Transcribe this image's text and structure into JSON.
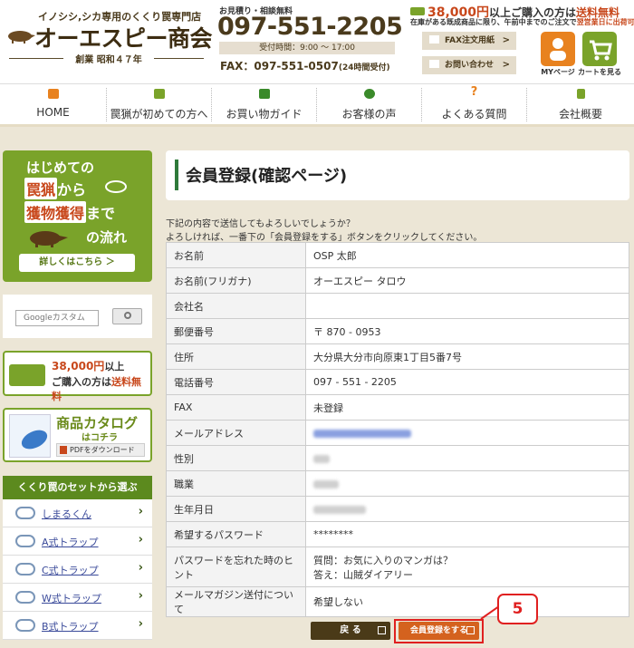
{
  "header": {
    "tagline": "イノシシ,シカ専用のくくり罠専門店",
    "company_name": "オーエスピー商会",
    "founded": "創業 昭和４７年",
    "quote_label": "お見積り・相談無料",
    "phone": "097-551-2205",
    "hours": "受付時間：9:00 ～ 17:00",
    "fax_label": "FAX：",
    "fax_number": "097-551-0507",
    "fax_note": "(24時間受付)",
    "free_ship_amount": "38,000円",
    "free_ship_mid": "以上ご購入の方は",
    "free_ship_strong": "送料無料",
    "same_day_prefix": "在庫がある既成商品に限り、午前中までのご注文で",
    "same_day_strong": "翌営業日に出荷可能",
    "fax_form_button": "FAX注文用紙",
    "contact_button": "お問い合わせ",
    "mypage_label": "MYページ",
    "cart_label": "カートを見る"
  },
  "nav": {
    "items": [
      {
        "label": "HOME"
      },
      {
        "label": "罠猟が初めての方へ"
      },
      {
        "label": "お買い物ガイド"
      },
      {
        "label": "お客様の声"
      },
      {
        "label": "よくある質問"
      },
      {
        "label": "会社概要"
      }
    ]
  },
  "sidebar": {
    "promo_line1": "はじめての",
    "promo_line2a": "罠猟",
    "promo_line2b": "から",
    "promo_line3a": "獲物獲得",
    "promo_line3b": "まで",
    "promo_line4": "の流れ",
    "promo_button": "詳しくはこちら ＞",
    "search_placeholder": "Googleカスタム",
    "ship_amount": "38,000円",
    "ship_suffix": "以上",
    "ship_line2a": "ご購入の方は",
    "ship_line2b": "送料無料",
    "catalog_title": "商品カタログ",
    "catalog_sub": "はコチラ",
    "catalog_pdf": "PDFをダウンロード",
    "trap_heading": "くくり罠のセットから選ぶ",
    "traps": [
      {
        "label": "しまるくん"
      },
      {
        "label": "A式トラップ"
      },
      {
        "label": "C式トラップ"
      },
      {
        "label": "W式トラップ"
      },
      {
        "label": "B式トラップ"
      }
    ]
  },
  "main": {
    "title": "会員登録(確認ページ)",
    "intro1": "下記の内容で送信してもよろしいでしょうか？",
    "intro2": "よろしければ、一番下の「会員登録をする」ボタンをクリックしてください。",
    "rows": [
      {
        "label": "お名前",
        "value": "OSP 太郎"
      },
      {
        "label": "お名前(フリガナ)",
        "value": "オーエスピー タロウ"
      },
      {
        "label": "会社名",
        "value": ""
      },
      {
        "label": "郵便番号",
        "value": "〒 870 - 0953"
      },
      {
        "label": "住所",
        "value": "大分県大分市向原東1丁目5番7号"
      },
      {
        "label": "電話番号",
        "value": "097 - 551 - 2205"
      },
      {
        "label": "FAX",
        "value": "未登録"
      },
      {
        "label": "メールアドレス",
        "value": ""
      },
      {
        "label": "性別",
        "value": ""
      },
      {
        "label": "職業",
        "value": ""
      },
      {
        "label": "生年月日",
        "value": ""
      },
      {
        "label": "希望するパスワード",
        "value": "********"
      },
      {
        "label": "パスワードを忘れた時のヒント",
        "value": "質問：お気に入りのマンガは？",
        "value2": "答え：山賊ダイアリー"
      },
      {
        "label": "メールマガジン送付について",
        "value": "希望しない"
      }
    ],
    "back_button": "戻 る",
    "submit_button": "会員登録をする",
    "step_number": "5"
  },
  "colors": {
    "accent_green": "#7aa32a",
    "dark_green": "#5c8a1e",
    "brown": "#4a3a18",
    "orange": "#d4621e",
    "highlight_red": "#e02020",
    "background": "#ece6d6"
  }
}
